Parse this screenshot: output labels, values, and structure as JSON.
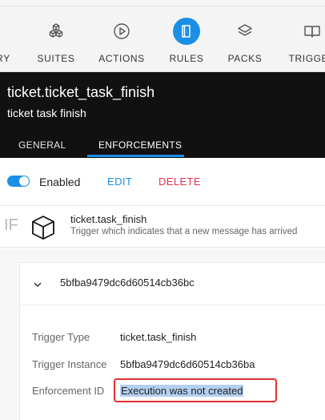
{
  "nav": {
    "items": [
      {
        "label": "RY",
        "icon": "history-icon"
      },
      {
        "label": "SUITES",
        "icon": "cubes-icon"
      },
      {
        "label": "ACTIONS",
        "icon": "play-icon"
      },
      {
        "label": "RULES",
        "icon": "book-icon",
        "active": true
      },
      {
        "label": "PACKS",
        "icon": "layers-icon"
      },
      {
        "label": "TRIGGER",
        "icon": "open-book-icon"
      }
    ]
  },
  "header": {
    "title": "ticket.ticket_task_finish",
    "description": "ticket task finish",
    "tabs": [
      "GENERAL",
      "ENFORCEMENTS"
    ],
    "active_tab": "ENFORCEMENTS"
  },
  "toolbar": {
    "enabled_label": "Enabled",
    "enabled": true,
    "edit_label": "EDIT",
    "delete_label": "DELETE"
  },
  "trigger": {
    "if_label": "IF",
    "name": "ticket.task_finish",
    "description": "Trigger which indicates that a new message has arrived"
  },
  "enforcement": {
    "id": "5bfba9479dc6d60514cb36bc",
    "rows": [
      {
        "label": "Trigger Type",
        "value": "ticket.task_finish"
      },
      {
        "label": "Trigger Instance",
        "value": "5bfba9479dc6d60514cb36ba"
      },
      {
        "label": "Enforcement ID",
        "value": "Execution was not created"
      }
    ]
  },
  "colors": {
    "accent": "#1b8fe6",
    "danger": "#e0334d",
    "header_bg": "#111112",
    "highlight_box": "#e42e2e"
  }
}
